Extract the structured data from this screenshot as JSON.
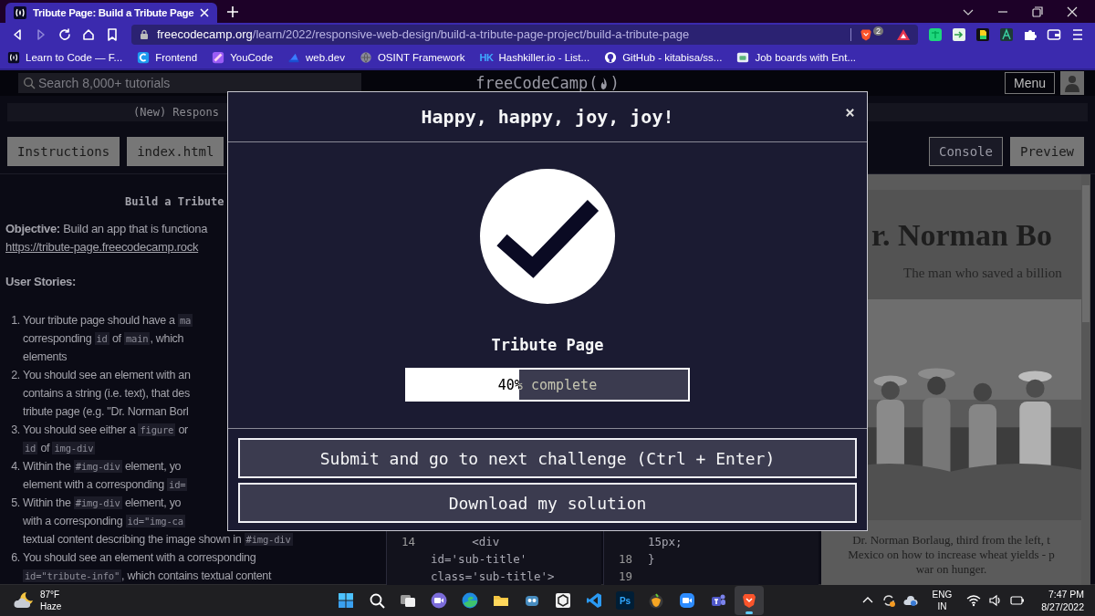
{
  "browser": {
    "tab": {
      "title": "Tribute Page: Build a Tribute Page",
      "selected": true
    },
    "address": {
      "domain": "freecodecamp.org",
      "path": "/learn/2022/responsive-web-design/build-a-tribute-page-project/build-a-tribute-page"
    },
    "shields_count": "2",
    "bookmarks": [
      {
        "label": "Learn to Code — F..."
      },
      {
        "label": "Frontend"
      },
      {
        "label": "YouCode"
      },
      {
        "label": "web.dev"
      },
      {
        "label": "OSINT Framework"
      },
      {
        "icon_text": "HK",
        "label": "Hashkiller.io - List..."
      },
      {
        "label": "GitHub - kitabisa/ss..."
      },
      {
        "label": "Job boards with Ent..."
      }
    ]
  },
  "nav": {
    "search": {
      "placeholder": "Search 8,000+ tutorials"
    },
    "logo": {
      "name": "freeCodeCamp",
      "open": "(",
      "close": ")"
    },
    "menu": "Menu"
  },
  "breadcrumb": "(New) Respons",
  "editor_tabs": [
    {
      "label": "Instructions",
      "selected": true
    },
    {
      "label": "index.html",
      "selected": true
    }
  ],
  "preview_tabs": [
    {
      "label": "Console",
      "selected": false
    },
    {
      "label": "Preview",
      "selected": true
    }
  ],
  "instructions": {
    "heading": "Build a Tribute",
    "objective": "**Objective:** Build an app that is functiona",
    "link": "https://tribute-page.freecodecamp.rock",
    "stories_title": "User Stories:",
    "stories": [
      {
        "number": "1.",
        "lines": [
          [
            {
              "text": "Your tribute page should have a ",
              "code": false
            },
            {
              "text": "ma",
              "code": true
            }
          ],
          [
            {
              "text": "corresponding ",
              "code": false
            },
            {
              "text": "id",
              "code": true
            },
            {
              "text": " of ",
              "code": false
            },
            {
              "text": "main",
              "code": true
            },
            {
              "text": ", which",
              "code": false
            }
          ],
          [
            {
              "text": "elements",
              "code": false
            }
          ]
        ]
      },
      {
        "number": "2.",
        "lines": [
          [
            {
              "text": "You should see an element with an",
              "code": false
            }
          ],
          [
            {
              "text": "contains a string (i.e. text), that des",
              "code": false
            }
          ],
          [
            {
              "text": "tribute page (e.g. \"Dr. Norman Borl",
              "code": false
            }
          ]
        ]
      },
      {
        "number": "3.",
        "lines": [
          [
            {
              "text": "You should see either a ",
              "code": false
            },
            {
              "text": "figure",
              "code": true
            },
            {
              "text": " or",
              "code": false
            }
          ],
          [
            {
              "text": "id",
              "code": true
            },
            {
              "text": " of ",
              "code": false
            },
            {
              "text": "img-div",
              "code": true
            }
          ]
        ]
      },
      {
        "number": "4.",
        "lines": [
          [
            {
              "text": "Within the ",
              "code": false
            },
            {
              "text": "#img-div",
              "code": true
            },
            {
              "text": " element, yo",
              "code": false
            }
          ],
          [
            {
              "text": "element with a corresponding ",
              "code": false
            },
            {
              "text": "id=",
              "code": true
            }
          ]
        ]
      },
      {
        "number": "5.",
        "lines": [
          [
            {
              "text": "Within the ",
              "code": false
            },
            {
              "text": "#img-div",
              "code": true
            },
            {
              "text": " element, yo",
              "code": false
            }
          ],
          [
            {
              "text": "with a corresponding ",
              "code": false
            },
            {
              "text": "id=\"img-ca",
              "code": true
            }
          ],
          [
            {
              "text": "textual content describing the image shown in ",
              "code": false
            },
            {
              "text": "#img-div",
              "code": true
            }
          ]
        ]
      },
      {
        "number": "6.",
        "lines": [
          [
            {
              "text": "You should see an element with a corresponding",
              "code": false
            }
          ],
          [
            {
              "text": "id=\"tribute-info\"",
              "code": true
            },
            {
              "text": ", which contains textual content",
              "code": false
            }
          ]
        ]
      }
    ]
  },
  "editor": {
    "panes": [
      {
        "lines": [
          {
            "number": "14",
            "code": "      <div"
          },
          {
            "code": "id='sub-title'"
          },
          {
            "code": "class='sub-title'>"
          }
        ]
      },
      {
        "lines": [
          {
            "code": "15px;"
          },
          {
            "number": "18",
            "code": "}"
          },
          {
            "number": "19"
          }
        ]
      }
    ]
  },
  "preview": {
    "heading": "r. Norman Bo",
    "subtitle": "The man who saved a billion",
    "caption": [
      "Dr. Norman Borlaug, third from the left, t",
      "Mexico on how to increase wheat yields - p",
      "war on hunger."
    ]
  },
  "modal": {
    "title": "Happy, happy, joy, joy!",
    "challenge": "Tribute Page",
    "progress": {
      "level": 0.4,
      "label": "40% complete"
    },
    "buttons": [
      "Submit and go to next challenge (Ctrl + Enter)",
      "Download my solution"
    ]
  },
  "taskbar": {
    "weather": {
      "temperature": "87°F",
      "condition": "Haze"
    },
    "apps": [
      {
        "selected": false
      },
      {
        "selected": false
      },
      {
        "selected": false
      },
      {
        "selected": false
      },
      {
        "selected": false
      },
      {
        "selected": false
      },
      {
        "selected": false
      },
      {
        "selected": false
      },
      {
        "selected": false
      },
      {
        "icon_text": "Ps",
        "selected": false
      },
      {
        "selected": false
      },
      {
        "selected": false
      },
      {
        "selected": false
      },
      {
        "selected": true
      }
    ],
    "tray": {
      "language": "ENG",
      "region": "IN",
      "time": "7:47 PM",
      "date": "8/27/2022"
    }
  }
}
